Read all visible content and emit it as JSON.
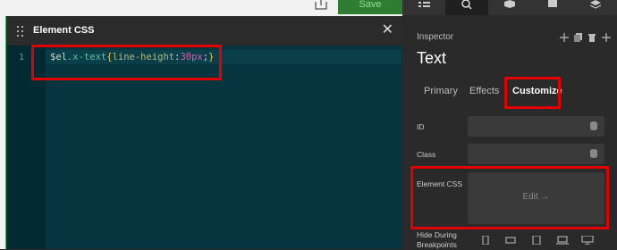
{
  "toolbar": {
    "save_label": "Save"
  },
  "editor": {
    "title": "Element CSS",
    "close_glyph": "✕",
    "line_number": "1",
    "fold_glyph": "▾",
    "code": {
      "var": "$el",
      "cls": ".x-text",
      "open": "{",
      "prop": "line-height",
      "colon": ":",
      "num": "30px",
      "semi": ";",
      "close": "}"
    }
  },
  "inspector": {
    "tab_icons": [
      "layers-icon",
      "search-icon",
      "cube-icon",
      "docs-icon",
      "stack-icon"
    ],
    "label": "Inspector",
    "title": "Text",
    "actions": [
      "move-icon",
      "copy-icon",
      "delete-icon",
      "more-icon"
    ],
    "subtabs": [
      "Primary",
      "Effects",
      "Customize"
    ],
    "active_subtab": "Customize",
    "fields": {
      "id_label": "ID",
      "class_label": "Class",
      "css_label": "Element CSS",
      "edit_label": "Edit →",
      "hide_label": "Hide During Breakpoints"
    }
  },
  "colors": {
    "highlight": "#e00000",
    "save_bg": "#2e7d32",
    "editor_bg": "#06343f"
  }
}
